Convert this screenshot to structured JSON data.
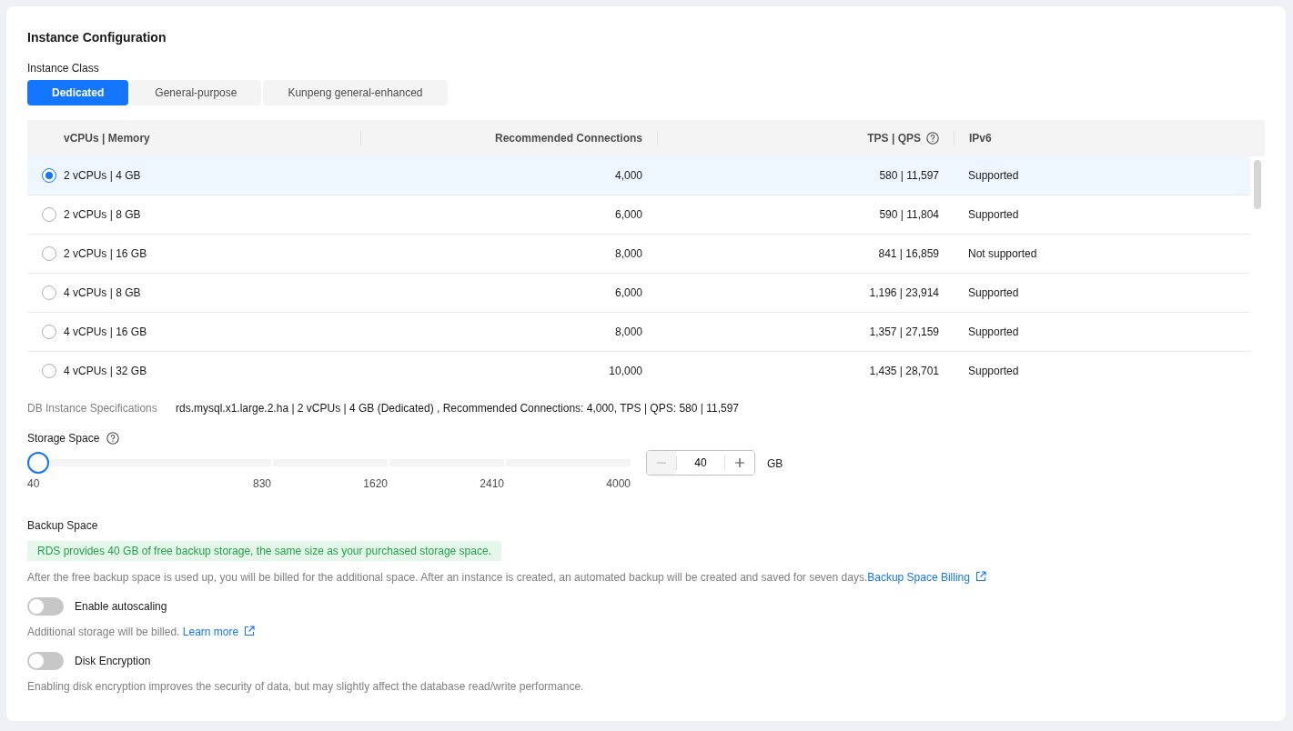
{
  "title": "Instance Configuration",
  "instance_class": {
    "label": "Instance Class",
    "tabs": [
      {
        "label": "Dedicated",
        "selected": true
      },
      {
        "label": "General-purpose",
        "selected": false
      },
      {
        "label": "Kunpeng general-enhanced",
        "selected": false
      }
    ]
  },
  "table": {
    "columns": [
      "vCPUs | Memory",
      "Recommended Connections",
      "TPS | QPS",
      "IPv6"
    ],
    "rows": [
      {
        "selected": true,
        "cells": [
          "2 vCPUs | 4 GB",
          "4,000",
          "580 | 11,597",
          "Supported"
        ]
      },
      {
        "selected": false,
        "cells": [
          "2 vCPUs | 8 GB",
          "6,000",
          "590 | 11,804",
          "Supported"
        ]
      },
      {
        "selected": false,
        "cells": [
          "2 vCPUs | 16 GB",
          "8,000",
          "841 | 16,859",
          "Not supported"
        ]
      },
      {
        "selected": false,
        "cells": [
          "4 vCPUs | 8 GB",
          "6,000",
          "1,196 | 23,914",
          "Supported"
        ]
      },
      {
        "selected": false,
        "cells": [
          "4 vCPUs | 16 GB",
          "8,000",
          "1,357 | 27,159",
          "Supported"
        ]
      },
      {
        "selected": false,
        "cells": [
          "4 vCPUs | 32 GB",
          "10,000",
          "1,435 | 28,701",
          "Supported"
        ]
      }
    ]
  },
  "specifications": {
    "label": "DB Instance Specifications",
    "value": "rds.mysql.x1.large.2.ha | 2 vCPUs | 4 GB (Dedicated) , Recommended Connections: 4,000, TPS | QPS: 580 | 11,597"
  },
  "storage": {
    "label": "Storage Space",
    "level": 0,
    "ticks": [
      "40",
      "830",
      "1620",
      "2410",
      "4000"
    ],
    "value": "40",
    "unit": "GB"
  },
  "backup": {
    "label": "Backup Space",
    "notice": "RDS provides 40 GB of free backup storage, the same size as your purchased storage space.",
    "description": "After the free backup space is used up, you will be billed for the additional space. After an instance is created, an automated backup will be created and saved for seven days.",
    "link": "Backup Space Billing"
  },
  "autoscaling": {
    "label": "Enable autoscaling",
    "on": false,
    "description": "Additional storage will be billed.",
    "link": "Learn more"
  },
  "encryption": {
    "label": "Disk Encryption",
    "on": false,
    "description": "Enabling disk encryption improves the security of data, but may slightly affect the database read/write performance."
  }
}
